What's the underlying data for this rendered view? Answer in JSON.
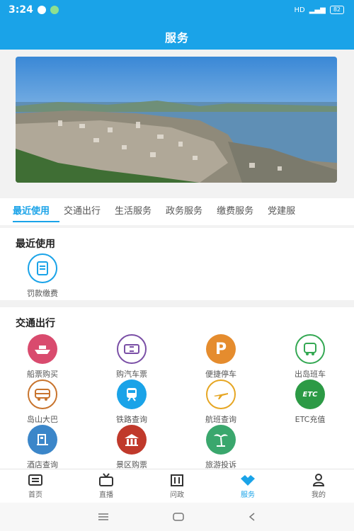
{
  "status_bar": {
    "time": "3:24",
    "battery": "82"
  },
  "header": {
    "title": "服务"
  },
  "tabs": [
    {
      "label": "最近使用"
    },
    {
      "label": "交通出行"
    },
    {
      "label": "生活服务"
    },
    {
      "label": "政务服务"
    },
    {
      "label": "缴费服务"
    },
    {
      "label": "党建服"
    }
  ],
  "recent": {
    "title": "最近使用",
    "items": [
      {
        "label": "罚款缴费",
        "icon": "receipt-icon"
      }
    ]
  },
  "transport": {
    "title": "交通出行",
    "items": [
      {
        "label": "船票购买",
        "icon": "ship-icon",
        "color": "#d94b6e"
      },
      {
        "label": "购汽车票",
        "icon": "ticket-icon",
        "color": "#7a4fa6"
      },
      {
        "label": "便捷停车",
        "icon": "parking-icon",
        "color": "#e58c2e"
      },
      {
        "label": "出岛班车",
        "icon": "bus-icon",
        "color": "#34a853"
      },
      {
        "label": "岛山大巴",
        "icon": "coach-icon",
        "color": "#c8742d"
      },
      {
        "label": "铁路查询",
        "icon": "train-icon",
        "color": "#1aa3e8"
      },
      {
        "label": "航班查询",
        "icon": "plane-icon",
        "color": "#e6a623"
      },
      {
        "label": "ETC充值",
        "icon": "etc-icon",
        "color": "#2c9a45"
      },
      {
        "label": "酒店查询",
        "icon": "hotel-icon",
        "color": "#3b86c9"
      },
      {
        "label": "景区购票",
        "icon": "scenic-icon",
        "color": "#c0392b"
      },
      {
        "label": "旅游投诉",
        "icon": "palm-icon",
        "color": "#3aa76d"
      }
    ]
  },
  "bottom_nav": [
    {
      "label": "首页",
      "icon": "home-icon"
    },
    {
      "label": "直播",
      "icon": "tv-icon"
    },
    {
      "label": "问政",
      "icon": "building-icon"
    },
    {
      "label": "服务",
      "icon": "service-icon"
    },
    {
      "label": "我的",
      "icon": "user-icon"
    }
  ],
  "accent": "#1aa3e8"
}
